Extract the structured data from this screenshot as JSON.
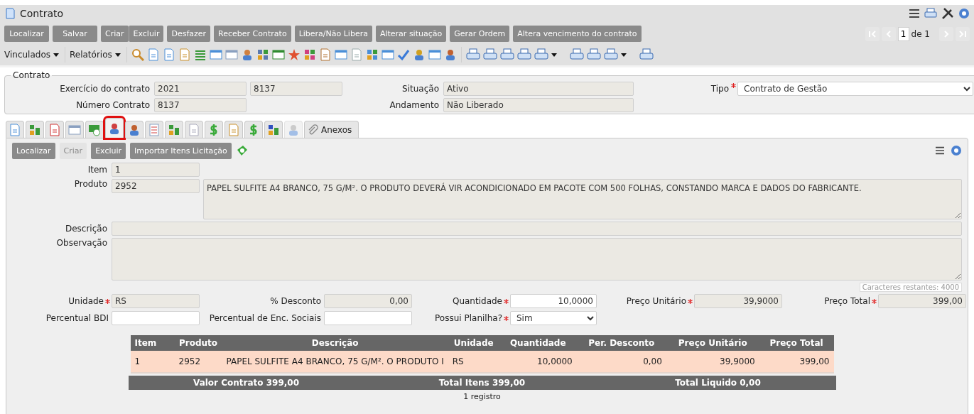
{
  "window": {
    "title": "Contrato"
  },
  "pager": {
    "page": "1",
    "of": "de 1"
  },
  "actions": [
    {
      "label": "Localizar",
      "joined": false
    },
    {
      "label": "Salvar",
      "joined": false
    },
    {
      "label": "Criar",
      "joined": false
    },
    {
      "label": "Excluir",
      "joined": true
    },
    {
      "label": "Desfazer",
      "joined": false
    },
    {
      "label": "Receber Contrato",
      "joined": false
    },
    {
      "label": "Libera/Não Libera",
      "joined": false
    },
    {
      "label": "Alterar situação",
      "joined": false
    },
    {
      "label": "Gerar Ordem",
      "joined": false
    },
    {
      "label": "Altera vencimento do contrato",
      "joined": false
    }
  ],
  "menus": [
    "Vinculados",
    "Relatórios"
  ],
  "contract": {
    "legend": "Contrato",
    "exercicio": {
      "label": "Exercício do contrato",
      "value": "2021",
      "value2": "8137"
    },
    "numero": {
      "label": "Número Contrato",
      "value": "8137"
    },
    "situacao": {
      "label": "Situação",
      "value": "Ativo"
    },
    "andamento": {
      "label": "Andamento",
      "value": "Não Liberado"
    },
    "tipo": {
      "label": "Tipo",
      "value": "Contrato de Gestão",
      "required": true
    }
  },
  "tabs": [
    {
      "selected": false
    },
    {
      "selected": false
    },
    {
      "selected": false
    },
    {
      "selected": false
    },
    {
      "selected": false
    },
    {
      "selected": true
    },
    {
      "selected": false
    },
    {
      "selected": false
    },
    {
      "selected": false
    },
    {
      "selected": false
    },
    {
      "selected": false
    },
    {
      "selected": false
    },
    {
      "selected": false
    },
    {
      "selected": false
    },
    {
      "selected": false,
      "disabled": true
    },
    {
      "selected": false,
      "label": "Anexos"
    }
  ],
  "item_actions": [
    {
      "label": "Localizar",
      "disabled": false
    },
    {
      "label": "Criar",
      "disabled": true
    },
    {
      "label": "Excluir",
      "disabled": false
    },
    {
      "label": "Importar Itens Licitação",
      "disabled": false
    }
  ],
  "item": {
    "label": "Item",
    "value": "1"
  },
  "produto": {
    "label": "Produto",
    "code": "2952",
    "description": "PAPEL SULFITE A4 BRANCO, 75 G/M². O PRODUTO DEVERÁ VIR ACONDICIONADO EM PACOTE COM 500 FOLHAS, CONSTANDO MARCA E DADOS DO FABRICANTE."
  },
  "descricao": {
    "label": "Descrição"
  },
  "observacao": {
    "label": "Observação",
    "counter": "Caracteres restantes: 4000"
  },
  "fields_row1": [
    {
      "label": "Unidade",
      "value": "RS",
      "required": true,
      "readonly": true
    },
    {
      "label": "% Desconto",
      "value": "0,00",
      "required": false,
      "readonly": true
    },
    {
      "label": "Quantidade",
      "value": "10,0000",
      "required": true,
      "readonly": false
    },
    {
      "label": "Preço Unitário",
      "value": "39,9000",
      "required": true,
      "readonly": true
    },
    {
      "label": "Preço Total",
      "value": "399,00",
      "required": true,
      "readonly": true
    }
  ],
  "fields_row2": [
    {
      "label": "Percentual BDI",
      "required": false,
      "kind": "input"
    },
    {
      "label": "Percentual de Enc. Sociais",
      "required": false,
      "kind": "input"
    },
    {
      "label": "Possui Planilha?",
      "value": "Sim",
      "required": true,
      "kind": "select"
    }
  ],
  "table": {
    "columns": [
      "Item",
      "Produto",
      "Descrição",
      "Unidade",
      "Quantidade",
      "Per. Desconto",
      "Preço Unitário",
      "Preço Total"
    ],
    "rows": [
      [
        "1",
        "2952",
        "PAPEL SULFITE A4 BRANCO, 75 G/M². O PRODUTO I",
        "RS",
        "10,0000",
        "0,00",
        "39,9000",
        "399,00"
      ]
    ],
    "totals": [
      "Valor Contrato 399,00",
      "Total Itens 399,00",
      "Total Liquido 0,00"
    ],
    "count": "1 registro"
  }
}
